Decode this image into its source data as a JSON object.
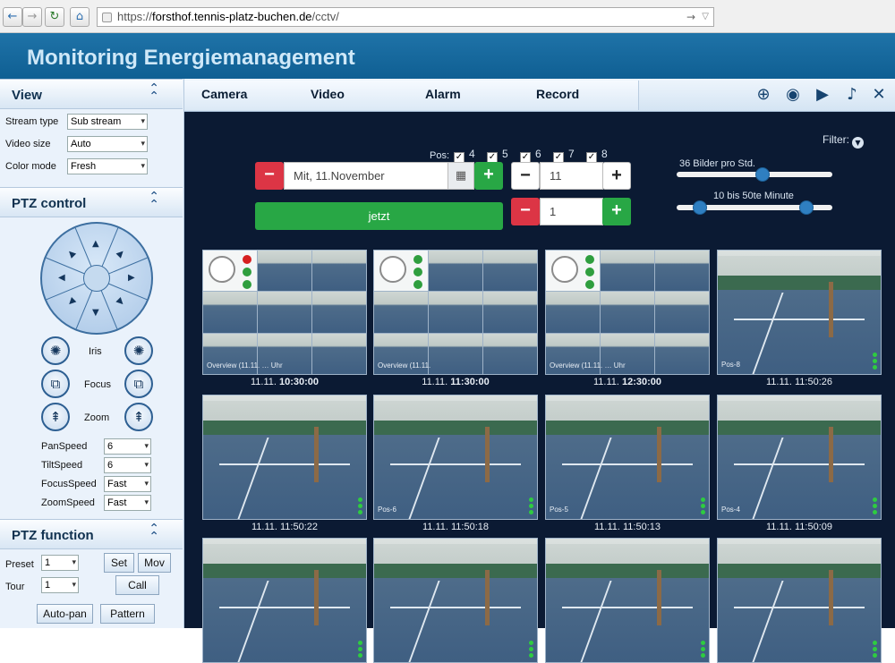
{
  "browser": {
    "back_icon": "back-arrow-icon",
    "url_prefix": "https://",
    "url_host": "forsthof.tennis-platz-buchen.de",
    "url_path": "/cctv/"
  },
  "app": {
    "title": "Monitoring Energiemanagement"
  },
  "view_panel": {
    "title": "View",
    "rows": [
      {
        "label": "Stream type",
        "value": "Sub stream"
      },
      {
        "label": "Video size",
        "value": "Auto"
      },
      {
        "label": "Color mode",
        "value": "Fresh"
      }
    ]
  },
  "ptz_control": {
    "title": "PTZ control",
    "iris": "Iris",
    "focus": "Focus",
    "zoom": "Zoom",
    "speeds": [
      {
        "label": "PanSpeed",
        "value": "6"
      },
      {
        "label": "TiltSpeed",
        "value": "6"
      },
      {
        "label": "FocusSpeed",
        "value": "Fast"
      },
      {
        "label": "ZoomSpeed",
        "value": "Fast"
      }
    ]
  },
  "ptz_function": {
    "title": "PTZ function",
    "preset_label": "Preset",
    "preset_value": "1",
    "tour_label": "Tour",
    "tour_value": "1",
    "set": "Set",
    "mov": "Mov",
    "call": "Call",
    "autopan": "Auto-pan",
    "pattern": "Pattern"
  },
  "tabs": [
    "Camera",
    "Video",
    "Alarm",
    "Record"
  ],
  "toolbar_icons": [
    "zoom-in-icon",
    "snapshot-camera-icon",
    "video-camera-icon",
    "talk-icon",
    "mute-icon"
  ],
  "controls": {
    "filter": "Filter:",
    "pos_label": "Pos:",
    "positions": [
      "4",
      "5",
      "6",
      "7",
      "8"
    ],
    "date_value": "Mit, 11.November",
    "hour_value": "11",
    "minute_value": "1",
    "now_button": "jetzt",
    "slider1_label": "36 Bilder pro Std.",
    "slider1_value": 36,
    "slider2_label": "10 bis 50te Minute",
    "slider2_range": [
      10,
      50
    ]
  },
  "thumbnails": [
    {
      "date": "11.11.",
      "time": "10:30:00",
      "bold": true,
      "type": "mosaic",
      "overlay": "Overview (11.11.",
      "overlay2": "Uhr"
    },
    {
      "date": "11.11.",
      "time": "11:30:00",
      "bold": true,
      "type": "mosaic",
      "overlay": "Overview (11.11.",
      "overlay2": ""
    },
    {
      "date": "11.11.",
      "time": "12:30:00",
      "bold": true,
      "type": "mosaic",
      "overlay": "Overview (11.11.",
      "overlay2": "Uhr"
    },
    {
      "date": "11.11.",
      "time": "11:50:26",
      "bold": false,
      "type": "court",
      "overlay": "Pos-8"
    },
    {
      "date": "11.11.",
      "time": "11:50:22",
      "bold": false,
      "type": "court",
      "overlay": ""
    },
    {
      "date": "11.11.",
      "time": "11:50:18",
      "bold": false,
      "type": "court",
      "overlay": "Pos-6"
    },
    {
      "date": "11.11.",
      "time": "11:50:13",
      "bold": false,
      "type": "court",
      "overlay": "Pos-5"
    },
    {
      "date": "11.11.",
      "time": "11:50:09",
      "bold": false,
      "type": "court",
      "overlay": "Pos-4"
    },
    {
      "date": "",
      "time": "",
      "bold": false,
      "type": "court",
      "overlay": ""
    },
    {
      "date": "",
      "time": "",
      "bold": false,
      "type": "court",
      "overlay": ""
    },
    {
      "date": "",
      "time": "",
      "bold": false,
      "type": "court",
      "overlay": ""
    },
    {
      "date": "",
      "time": "",
      "bold": false,
      "type": "court",
      "overlay": ""
    }
  ]
}
